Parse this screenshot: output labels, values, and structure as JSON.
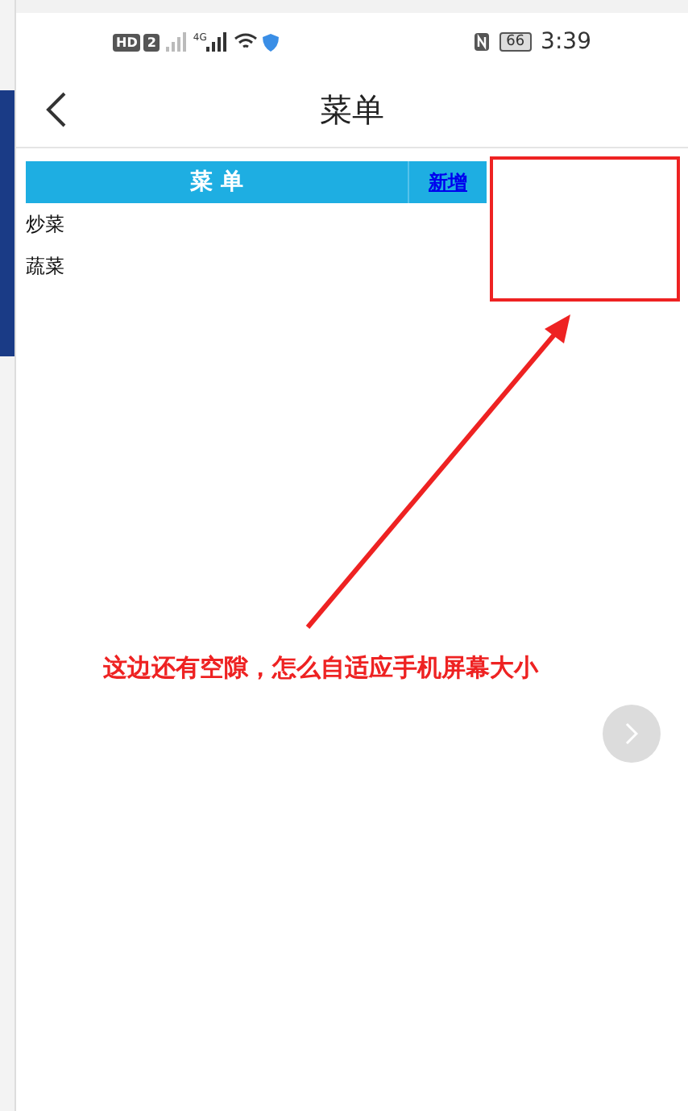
{
  "status_bar": {
    "hd": "HD",
    "sim": "2",
    "network": "4G",
    "battery": "66",
    "time": "3:39"
  },
  "header": {
    "title": "菜单"
  },
  "table": {
    "heading": "菜 单",
    "add_link": "新增",
    "rows": [
      "炒菜",
      "蔬菜"
    ]
  },
  "annotation": {
    "text": "这边还有空隙，怎么自适应手机屏幕大小"
  }
}
